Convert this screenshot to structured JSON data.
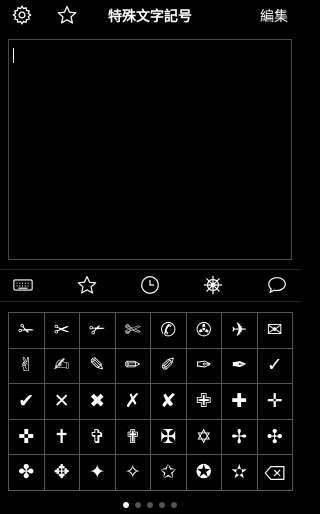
{
  "header": {
    "title": "特殊文字記号",
    "edit_label": "編集",
    "left_icons": [
      "gear-icon",
      "star-icon"
    ]
  },
  "editor": {
    "value": ""
  },
  "tabs": [
    {
      "name": "keyboard-icon",
      "active": false
    },
    {
      "name": "star-icon",
      "active": false
    },
    {
      "name": "clock-icon",
      "active": false
    },
    {
      "name": "ship-wheel-icon",
      "active": true
    },
    {
      "name": "speech-bubble-icon",
      "active": false
    }
  ],
  "symbols": [
    "✁",
    "✂",
    "✃",
    "✄",
    "✆",
    "✇",
    "✈",
    "✉",
    "✌",
    "✍",
    "✎",
    "✏",
    "✐",
    "✑",
    "✒",
    "✓",
    "✔",
    "✕",
    "✖",
    "✗",
    "✘",
    "✙",
    "✚",
    "✛",
    "✜",
    "✝",
    "✞",
    "✟",
    "✠",
    "✡",
    "✢",
    "✣",
    "✤",
    "✥",
    "✦",
    "✧",
    "✩",
    "✪",
    "✫"
  ],
  "delete_key": "delete-key-icon",
  "page_indicator": {
    "count": 5,
    "current": 1
  }
}
